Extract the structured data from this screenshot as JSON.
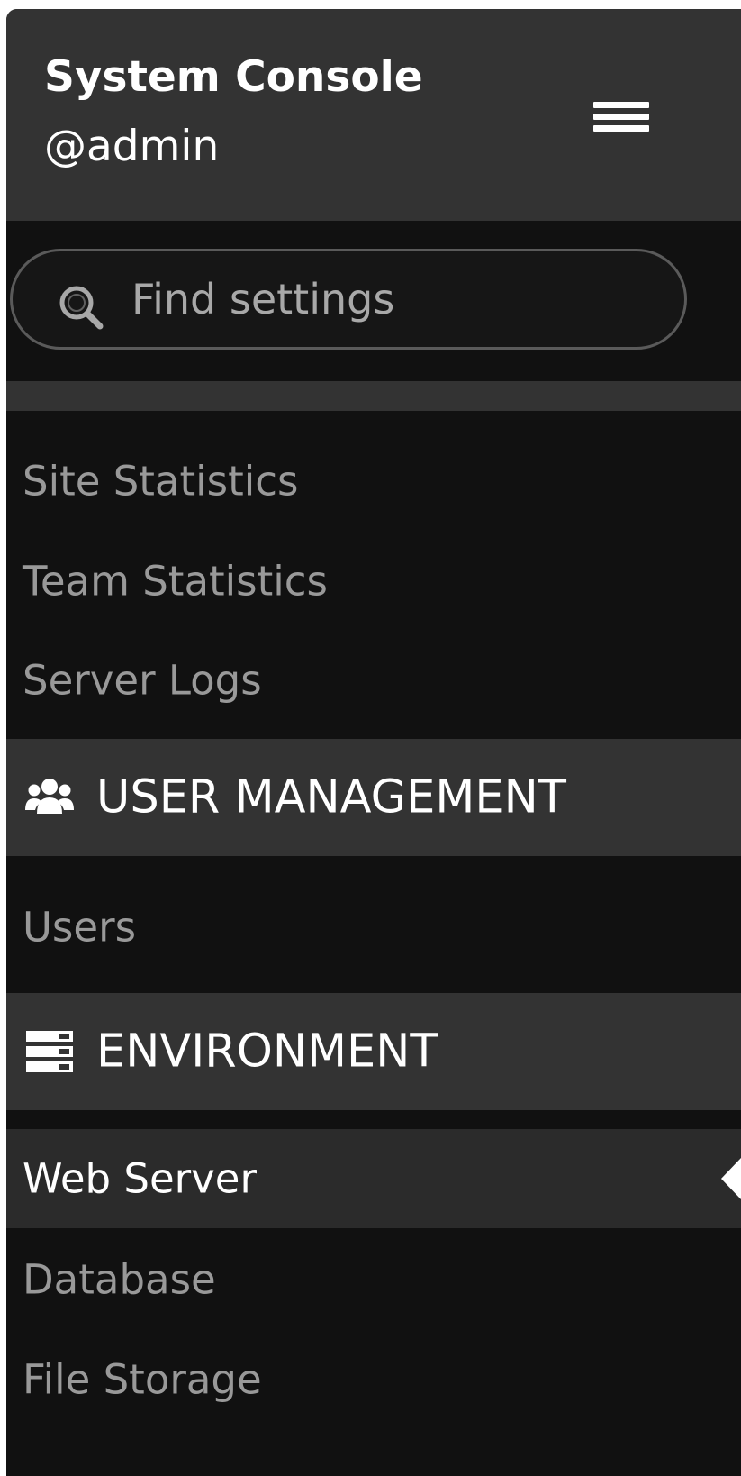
{
  "header": {
    "title": "System Console",
    "username": "@admin",
    "menu_icon": "hamburger-icon"
  },
  "search": {
    "placeholder": "Find settings",
    "value": "",
    "icon": "search-icon"
  },
  "reporting_items": [
    {
      "label": "Site Statistics"
    },
    {
      "label": "Team Statistics"
    },
    {
      "label": "Server Logs"
    }
  ],
  "sections": {
    "user_management": {
      "title": "USER MANAGEMENT",
      "icon": "users-icon",
      "items": [
        {
          "label": "Users"
        }
      ]
    },
    "environment": {
      "title": "ENVIRONMENT",
      "icon": "server-icon",
      "items": [
        {
          "label": "Web Server",
          "active": true
        },
        {
          "label": "Database"
        },
        {
          "label": "File Storage"
        }
      ]
    }
  },
  "colors": {
    "header_bg": "#333333",
    "sidebar_bg": "#111111",
    "active_bg": "#2b2b2b",
    "item_text": "#999999",
    "active_text": "#ffffff"
  }
}
